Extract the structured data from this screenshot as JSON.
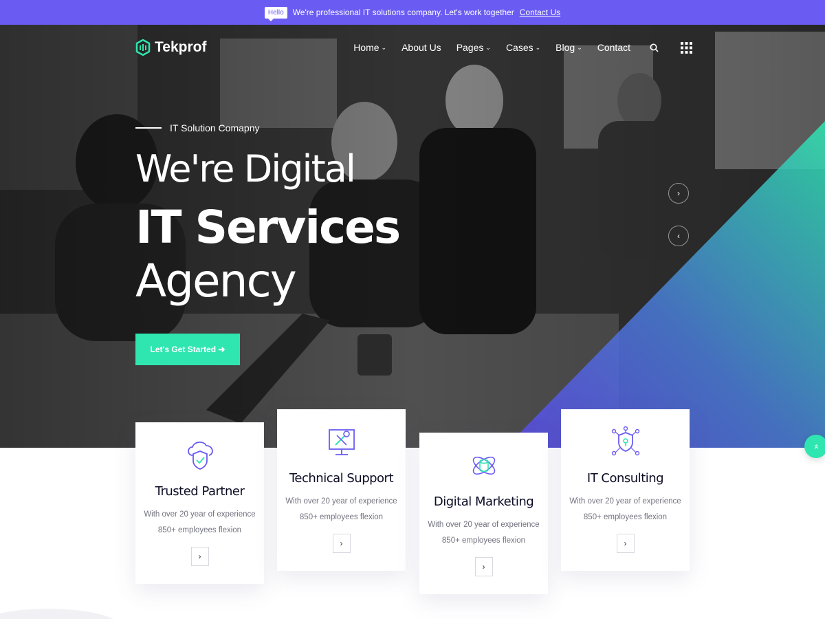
{
  "topbar": {
    "badge": "Hello",
    "message": "We're professional IT solutions company. Let's work together",
    "link": "Contact Us"
  },
  "brand": {
    "name": "Tekprof"
  },
  "nav": {
    "items": [
      {
        "label": "Home",
        "dropdown": true
      },
      {
        "label": "About Us",
        "dropdown": false
      },
      {
        "label": "Pages",
        "dropdown": true
      },
      {
        "label": "Cases",
        "dropdown": true
      },
      {
        "label": "Blog",
        "dropdown": true
      },
      {
        "label": "Contact",
        "dropdown": false
      }
    ],
    "icons": [
      "search-icon",
      "grid-menu-icon"
    ]
  },
  "hero": {
    "tagline": "IT Solution Comapny",
    "line1": "We're Digital",
    "line2": "IT Services",
    "line3": "Agency",
    "cta": "Let's Get Started ➜",
    "next": "›",
    "prev": "‹"
  },
  "cards": [
    {
      "title": "Trusted Partner",
      "line1": "With over 20 year of experience",
      "line2": "850+ employees flexion",
      "icon": "cloud-shield-icon",
      "arrow": "›"
    },
    {
      "title": "Technical Support",
      "line1": "With over 20 year of experience",
      "line2": "850+ employees flexion",
      "icon": "monitor-tools-icon",
      "arrow": "›"
    },
    {
      "title": "Digital Marketing",
      "line1": "With over 20 year of experience",
      "line2": "850+ employees flexion",
      "icon": "database-orbit-icon",
      "arrow": "›"
    },
    {
      "title": "IT Consulting",
      "line1": "With over 20 year of experience",
      "line2": "850+ employees flexion",
      "icon": "network-shield-icon",
      "arrow": "›"
    }
  ],
  "scroll_top": "»",
  "colors": {
    "primary": "#6a5cf2",
    "accent": "#2fe6b0",
    "dark": "#0c0c25"
  }
}
